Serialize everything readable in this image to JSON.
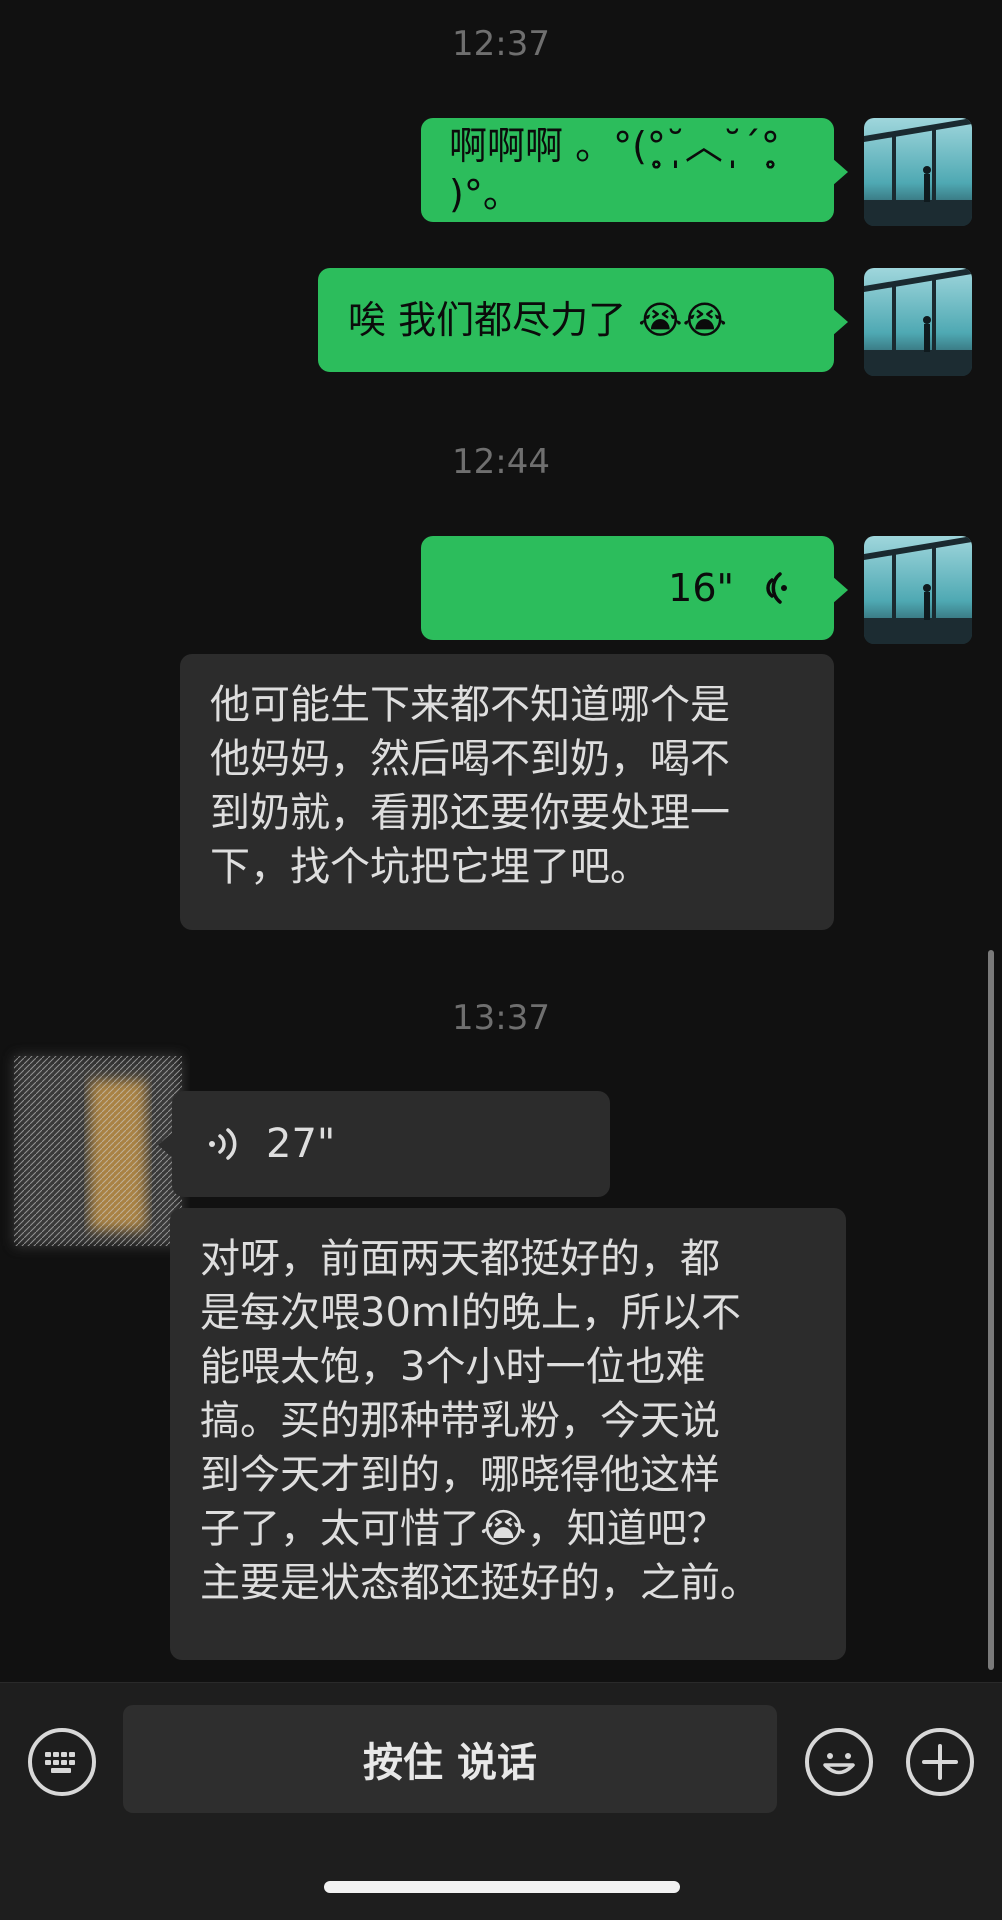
{
  "chat": {
    "timestamps": [
      "12:37",
      "12:44",
      "13:37"
    ],
    "sent_messages": [
      {
        "text": "啊啊啊 。°(°̥̥̥̥̥̥̥̥˘̩̩̩̩̩̩︿˘̩̩̩̩̩̩̩ˊ°̥̥̥̥̥̥̥̥ )°。"
      },
      {
        "text": "唉 我们都尽力了 😭😭"
      }
    ],
    "sent_voice": {
      "duration": "16\""
    },
    "received_messages": [
      {
        "text": "他可能生下来都不知道哪个是\n他妈妈，然后喝不到奶，喝不\n到奶就，看那还要你要处理一\n下，找个坑把它埋了吧。"
      },
      {
        "text": "对呀，前面两天都挺好的，都\n是每次喂30ml的晚上，所以不\n能喂太饱，3个小时一位也难\n搞。买的那种带乳粉，今天说\n到今天才到的，哪晓得他这样\n子了，太可惜了😭，知道吧？\n主要是状态都还挺好的，之前。"
      }
    ],
    "received_voice": {
      "duration": "27\""
    }
  },
  "input_bar": {
    "talk_label": "按住 说话",
    "keyboard_icon": "keyboard-icon",
    "emoji_icon": "emoji-icon",
    "plus_icon": "plus-icon"
  },
  "colors": {
    "background": "#111111",
    "sent_bubble": "#2cbd5c",
    "received_bubble": "#2c2c2c",
    "input_bar": "#1e1e1e"
  }
}
